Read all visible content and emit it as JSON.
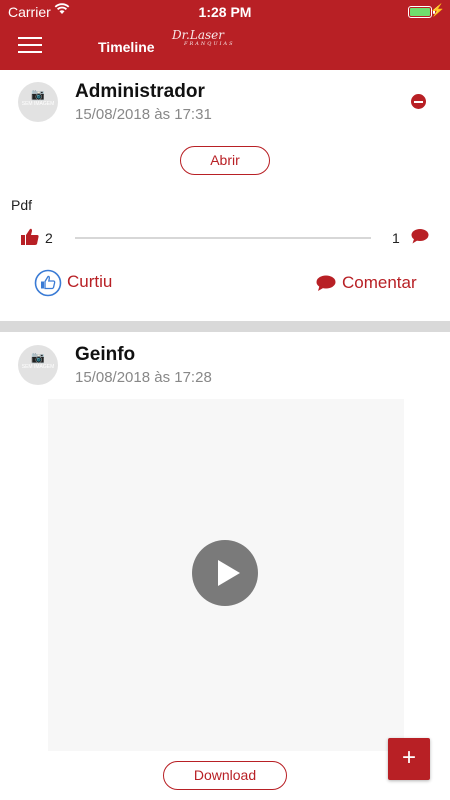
{
  "status_bar": {
    "carrier": "Carrier",
    "time": "1:28 PM"
  },
  "header": {
    "title": "Timeline",
    "logo": "Dr.Laser",
    "logo_sub": "FRANQUIAS"
  },
  "colors": {
    "brand": "#b82025",
    "placeholder": "#e2e2e2",
    "separator": "#d9d9d9"
  },
  "posts": [
    {
      "author": "Administrador",
      "date": "15/08/2018 às 17:31",
      "avatar_text": "SEM IMAGEM",
      "open_label": "Abrir",
      "attachment_label": "Pdf",
      "likes": "2",
      "comments": "1",
      "like_action": "Curtiu",
      "comment_action": "Comentar"
    },
    {
      "author": "Geinfo",
      "date": "15/08/2018 às 17:28",
      "avatar_text": "SEM IMAGEM",
      "download_label": "Download"
    }
  ],
  "fab": {
    "label": "+"
  }
}
